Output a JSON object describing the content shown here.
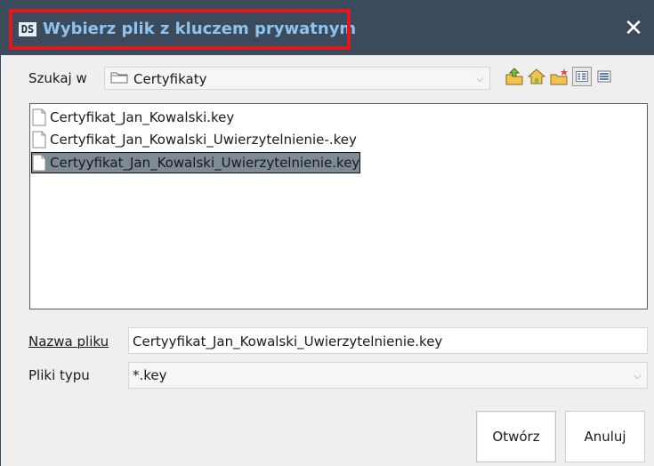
{
  "window": {
    "title": "Wybierz plik z kluczem prywatnym",
    "logo": "DS",
    "close_symbol": "✕"
  },
  "toolbar": {
    "look_in_label": "Szukaj w",
    "folder": "Certyfikaty",
    "icons": [
      "up-folder-icon",
      "home-icon",
      "new-folder-icon",
      "list-view-icon",
      "details-view-icon"
    ]
  },
  "files": [
    {
      "name": "Certyfikat_Jan_Kowalski.key",
      "selected": false
    },
    {
      "name": "Certyfikat_Jan_Kowalski_Uwierzytelnienie-.key",
      "selected": false
    },
    {
      "name": "Certyyfikat_Jan_Kowalski_Uwierzytelnienie.key",
      "selected": true
    }
  ],
  "filename": {
    "label": "Nazwa pliku",
    "value": "Certyyfikat_Jan_Kowalski_Uwierzytelnienie.key"
  },
  "filetype": {
    "label": "Pliki typu",
    "value": "*.key"
  },
  "buttons": {
    "open": "Otwórz",
    "cancel": "Anuluj"
  },
  "colors": {
    "titlebar": "#3b4b5c",
    "title_text": "#8fc3ef",
    "highlight": "#e3181f",
    "selection": "#7e8a95"
  }
}
